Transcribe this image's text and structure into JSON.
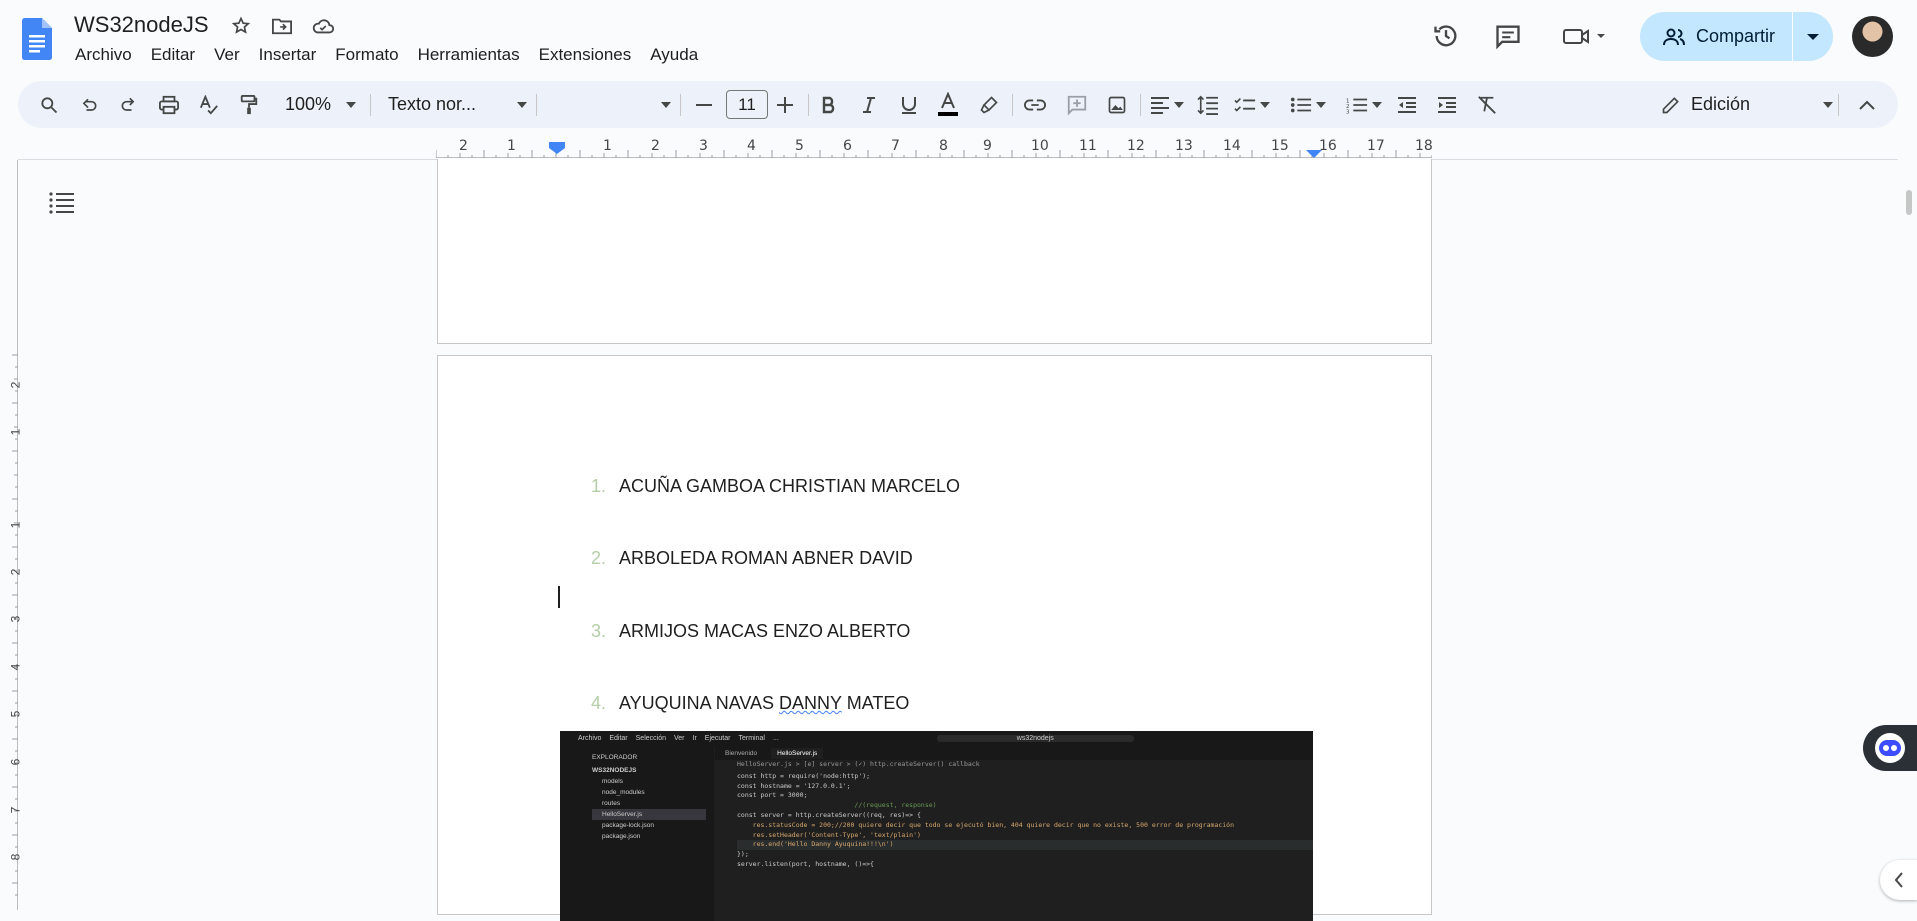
{
  "window": {
    "title": "WS32nodeJS"
  },
  "menu": [
    "Archivo",
    "Editar",
    "Ver",
    "Insertar",
    "Formato",
    "Herramientas",
    "Extensiones",
    "Ayuda"
  ],
  "share": {
    "label": "Compartir"
  },
  "toolbar": {
    "zoom": "100%",
    "style": "Texto nor...",
    "font_family": "",
    "font_size": "11",
    "mode": "Edición"
  },
  "ruler": {
    "numbers": [
      "2",
      "1",
      "1",
      "2",
      "3",
      "4",
      "5",
      "6",
      "7",
      "8",
      "9",
      "10",
      "11",
      "12",
      "13",
      "14",
      "15",
      "16",
      "17",
      "18"
    ]
  },
  "vruler": {
    "numbers": [
      "2",
      "1",
      "1",
      "2",
      "3",
      "4",
      "5",
      "6",
      "7",
      "8"
    ]
  },
  "document": {
    "list": [
      {
        "num": "1.",
        "text": "ACUÑA GAMBOA CHRISTIAN MARCELO"
      },
      {
        "num": "2.",
        "text": "ARBOLEDA ROMAN ABNER DAVID"
      },
      {
        "num": "3.",
        "text": "ARMIJOS MACAS ENZO ALBERTO"
      },
      {
        "num": "4.",
        "text_before": "AYUQUINA NAVAS ",
        "text_underlined": "DANNY",
        "text_after": " MATEO"
      }
    ]
  },
  "embedded_screenshot": {
    "titlebar": [
      "Archivo",
      "Editar",
      "Selección",
      "Ver",
      "Ir",
      "Ejecutar",
      "Terminal",
      "...",
      "ws32nodejs"
    ],
    "tabs": [
      "Bienvenido",
      "HelloServer.js"
    ],
    "breadcrumb": "HelloServer.js > [e] server > (✓) http.createServer() callback",
    "explorer_title": "EXPLORADOR",
    "explorer_root": "WS32NODEJS",
    "explorer_items": [
      "models",
      "node_modules",
      "routes",
      "HelloServer.js",
      "package-lock.json",
      "package.json"
    ],
    "code_lines": [
      "const http = require('node:http');",
      "",
      "const hostname = '127.0.0.1';",
      "const port = 3000;",
      "                              //(request, response)",
      "const server = http.createServer((req, res)=> {",
      "",
      "    res.statusCode = 200;//200 quiere decir que todo se ejecutó bien, 404 quiere decir que no existe, 500 error de programación",
      "    res.setHeader('Content-Type', 'text/plain')",
      "    res.end('Hello Danny Ayuquina!!!\\n')",
      "",
      "});",
      "",
      "server.listen(port, hostname, ()=>{"
    ]
  }
}
